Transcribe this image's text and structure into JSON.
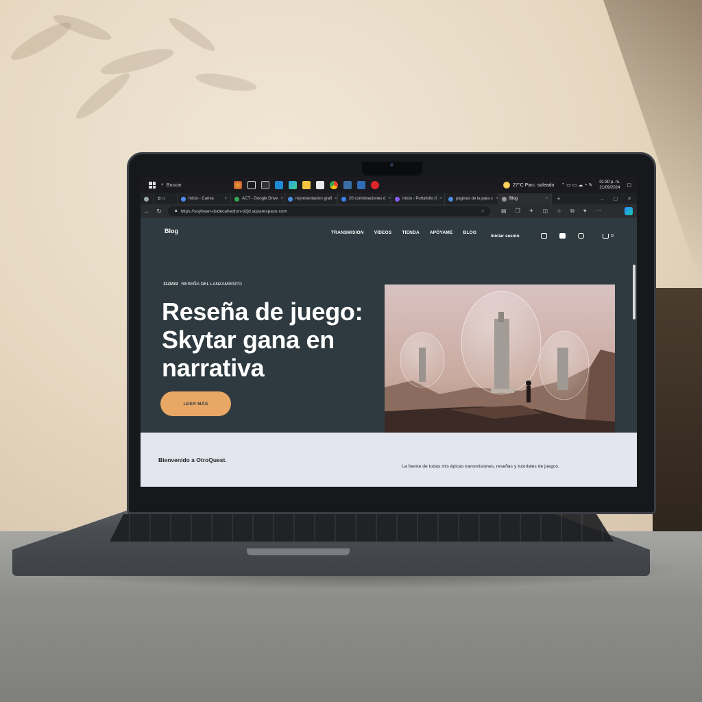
{
  "taskbar": {
    "search_label": "Buscar",
    "weather": "27°C  Parc. soleado",
    "time": "01:30 p. m.",
    "date": "21/09/2024"
  },
  "browser": {
    "tabs": [
      {
        "label": "Inicio - Canva",
        "color": "#4c8df6"
      },
      {
        "label": "ACT - Google Drive",
        "color": "#34a853"
      },
      {
        "label": "representacion grafi",
        "color": "#4a90e2"
      },
      {
        "label": "20 combinaciones d",
        "color": "#3b82f6"
      },
      {
        "label": "Inicio - Portafolio (I",
        "color": "#8b5cf6"
      },
      {
        "label": "paginas de la para c",
        "color": "#4a90e2"
      },
      {
        "label": "Blog",
        "color": "#999999"
      }
    ],
    "url": "https://soybean-dodecahedron-b2jd.squarespace.com"
  },
  "site": {
    "brand": "Blog",
    "nav": [
      "TRANSMISIÓN",
      "VÍDEOS",
      "TIENDA",
      "APÓYAME",
      "BLOG"
    ],
    "signin": "Iniciar sesión",
    "cart_count": "0",
    "post_date": "11/3/19",
    "post_category": "RESEÑA DEL LANZAMIENTO",
    "headline": "Reseña de juego: Skytar gana en narrativa",
    "cta": "LEER MÁS",
    "welcome_title": "Bienvenido a OtroQuest.",
    "welcome_desc": "La fuente de todas mis épicas transmisiones, reseñas y tutoriales de juegos."
  },
  "colors": {
    "site_bg": "#2e3a3f",
    "accent": "#e9a765",
    "band_bg": "#e4e6ef"
  }
}
